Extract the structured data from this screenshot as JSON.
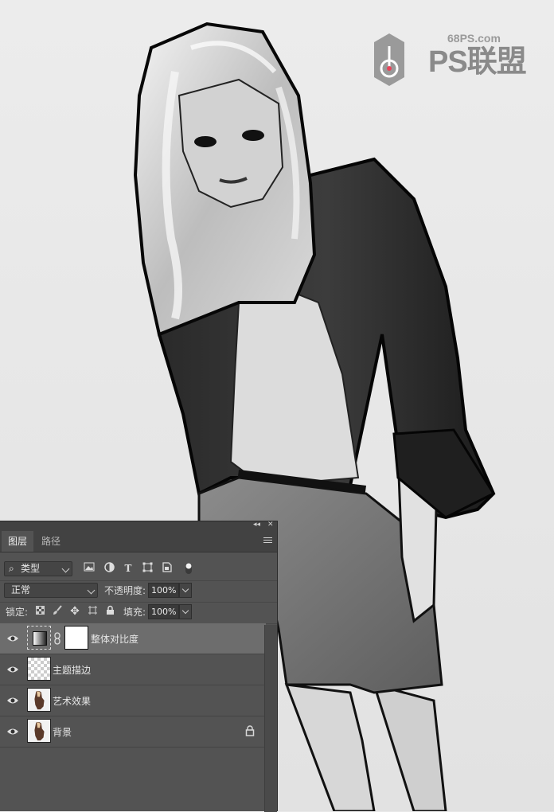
{
  "watermark": {
    "url": "68PS.com",
    "name": "PS联盟"
  },
  "colors": {
    "panel_bg": "#535353",
    "panel_tab_bg": "#424242",
    "selected_layer": "#6d6d6d",
    "canvas_bg": "#e9e9e9"
  },
  "panel": {
    "tabs": [
      {
        "label": "图层",
        "active": true
      },
      {
        "label": "路径",
        "active": false
      }
    ],
    "filter": {
      "kind_label": "类型",
      "icons": [
        "image-filter-icon",
        "adjustment-filter-icon",
        "type-filter-icon",
        "shape-filter-icon",
        "smart-object-filter-icon",
        "filter-toggle-icon"
      ]
    },
    "blend": {
      "mode": "正常",
      "opacity_label": "不透明度:",
      "opacity_value": "100%"
    },
    "lock": {
      "label": "锁定:",
      "icons": [
        "lock-transparent-icon",
        "lock-paint-icon",
        "lock-move-icon",
        "lock-artboard-icon",
        "lock-all-icon"
      ],
      "fill_label": "填充:",
      "fill_value": "100%"
    },
    "layers": [
      {
        "name": "整体对比度",
        "type": "adjustment",
        "selected": true,
        "locked": false
      },
      {
        "name": "主题描边",
        "type": "transparent",
        "selected": false,
        "locked": false
      },
      {
        "name": "艺术效果",
        "type": "photo",
        "selected": false,
        "locked": false
      },
      {
        "name": "背景",
        "type": "photo",
        "selected": false,
        "locked": true
      }
    ]
  }
}
